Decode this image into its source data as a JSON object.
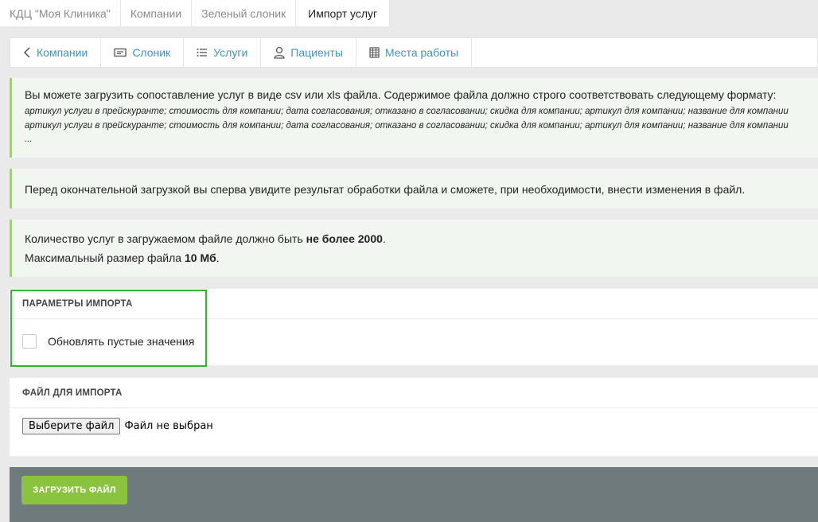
{
  "breadcrumbs": [
    {
      "label": "КДЦ \"Моя Клиника\""
    },
    {
      "label": "Компании"
    },
    {
      "label": "Зеленый слоник"
    },
    {
      "label": "Импорт услуг"
    }
  ],
  "tabs": [
    {
      "label": "Компании",
      "icon": "chevron-left-icon"
    },
    {
      "label": "Слоник",
      "icon": "card-icon"
    },
    {
      "label": "Услуги",
      "icon": "list-icon"
    },
    {
      "label": "Пациенты",
      "icon": "user-icon"
    },
    {
      "label": "Места работы",
      "icon": "building-icon"
    }
  ],
  "info": {
    "lead": "Вы можете загрузить сопоставление услуг в виде csv или xls файла. Содержимое файла должно строго соответствовать следующему формату:",
    "format_line_1": "артикул услуги в прейскуранте; стоимость для компании; дата согласования; отказано в согласовании; скидка для компании; артикул для компании; название для компании",
    "format_line_2": "артикул услуги в прейскуранте; стоимость для компании; дата согласования; отказано в согласовании; скидка для компании; артикул для компании; название для компании",
    "format_ellipsis": "...",
    "preview_note": "Перед окончательной загрузкой вы сперва увидите результат обработки файла и сможете, при необходимости, внести изменения в файл.",
    "limit_count_prefix": "Количество услуг в загружаемом файле должно быть ",
    "limit_count_value": "не более 2000",
    "limit_count_suffix": ".",
    "limit_size_prefix": "Максимальный размер файла ",
    "limit_size_value": "10 Мб",
    "limit_size_suffix": "."
  },
  "import_params": {
    "title": "ПАРАМЕТРЫ ИМПОРТА",
    "update_empty_label": "Обновлять пустые значения",
    "update_empty_checked": false
  },
  "file_section": {
    "title": "ФАЙЛ ДЛЯ ИМПОРТА",
    "choose_button": "Выберите файл",
    "status": "Файл не выбран"
  },
  "actions": {
    "upload_button": "ЗАГРУЗИТЬ ФАЙЛ"
  },
  "colors": {
    "link": "#3a97c4",
    "note_bg": "#f1f7f0",
    "note_border": "#a3cf7c",
    "footer_bg": "#6f7a7c",
    "primary_button": "#8ac43f",
    "highlight": "#2eb82e"
  }
}
